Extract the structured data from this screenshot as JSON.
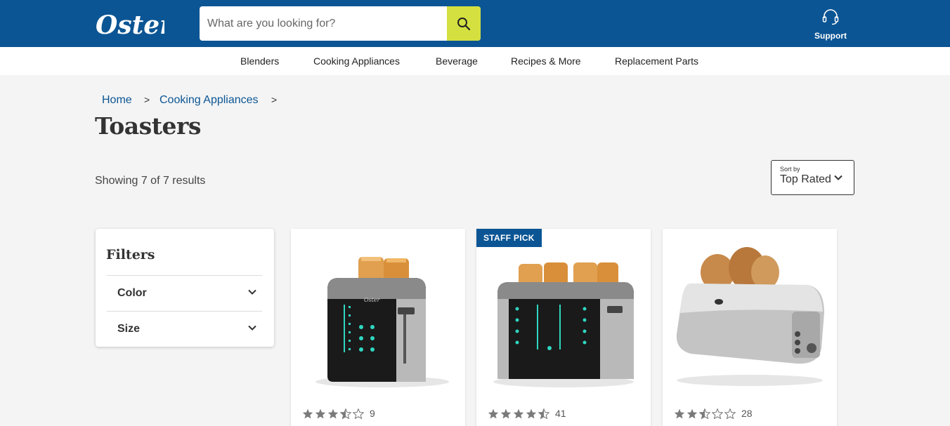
{
  "brand": {
    "logo_text": "Oster"
  },
  "search": {
    "placeholder": "What are you looking for?",
    "button_icon": "search-icon"
  },
  "support": {
    "label": "Support",
    "icon": "headset-icon"
  },
  "nav": {
    "items": [
      "Blenders",
      "Cooking Appliances",
      "Beverage",
      "Recipes & More",
      "Replacement Parts"
    ]
  },
  "breadcrumb": {
    "items": [
      "Home",
      "Cooking Appliances"
    ],
    "separator": ">"
  },
  "page": {
    "title": "Toasters",
    "results_text": "Showing 7 of 7 results"
  },
  "sort": {
    "label": "Sort by",
    "value": "Top Rated"
  },
  "filters": {
    "title": "Filters",
    "groups": [
      "Color",
      "Size"
    ]
  },
  "products": [
    {
      "badge": "",
      "rating": 3.5,
      "review_count": "9",
      "image": "2-slice black digital toaster"
    },
    {
      "badge": "STAFF PICK",
      "rating": 4.5,
      "review_count": "41",
      "image": "4-slice black digital toaster"
    },
    {
      "badge": "",
      "rating": 2.5,
      "review_count": "28",
      "image": "long-slot stainless toaster"
    }
  ],
  "colors": {
    "header_blue": "#0b5594",
    "search_button": "#d4e040",
    "star": "#7a7a7a"
  }
}
